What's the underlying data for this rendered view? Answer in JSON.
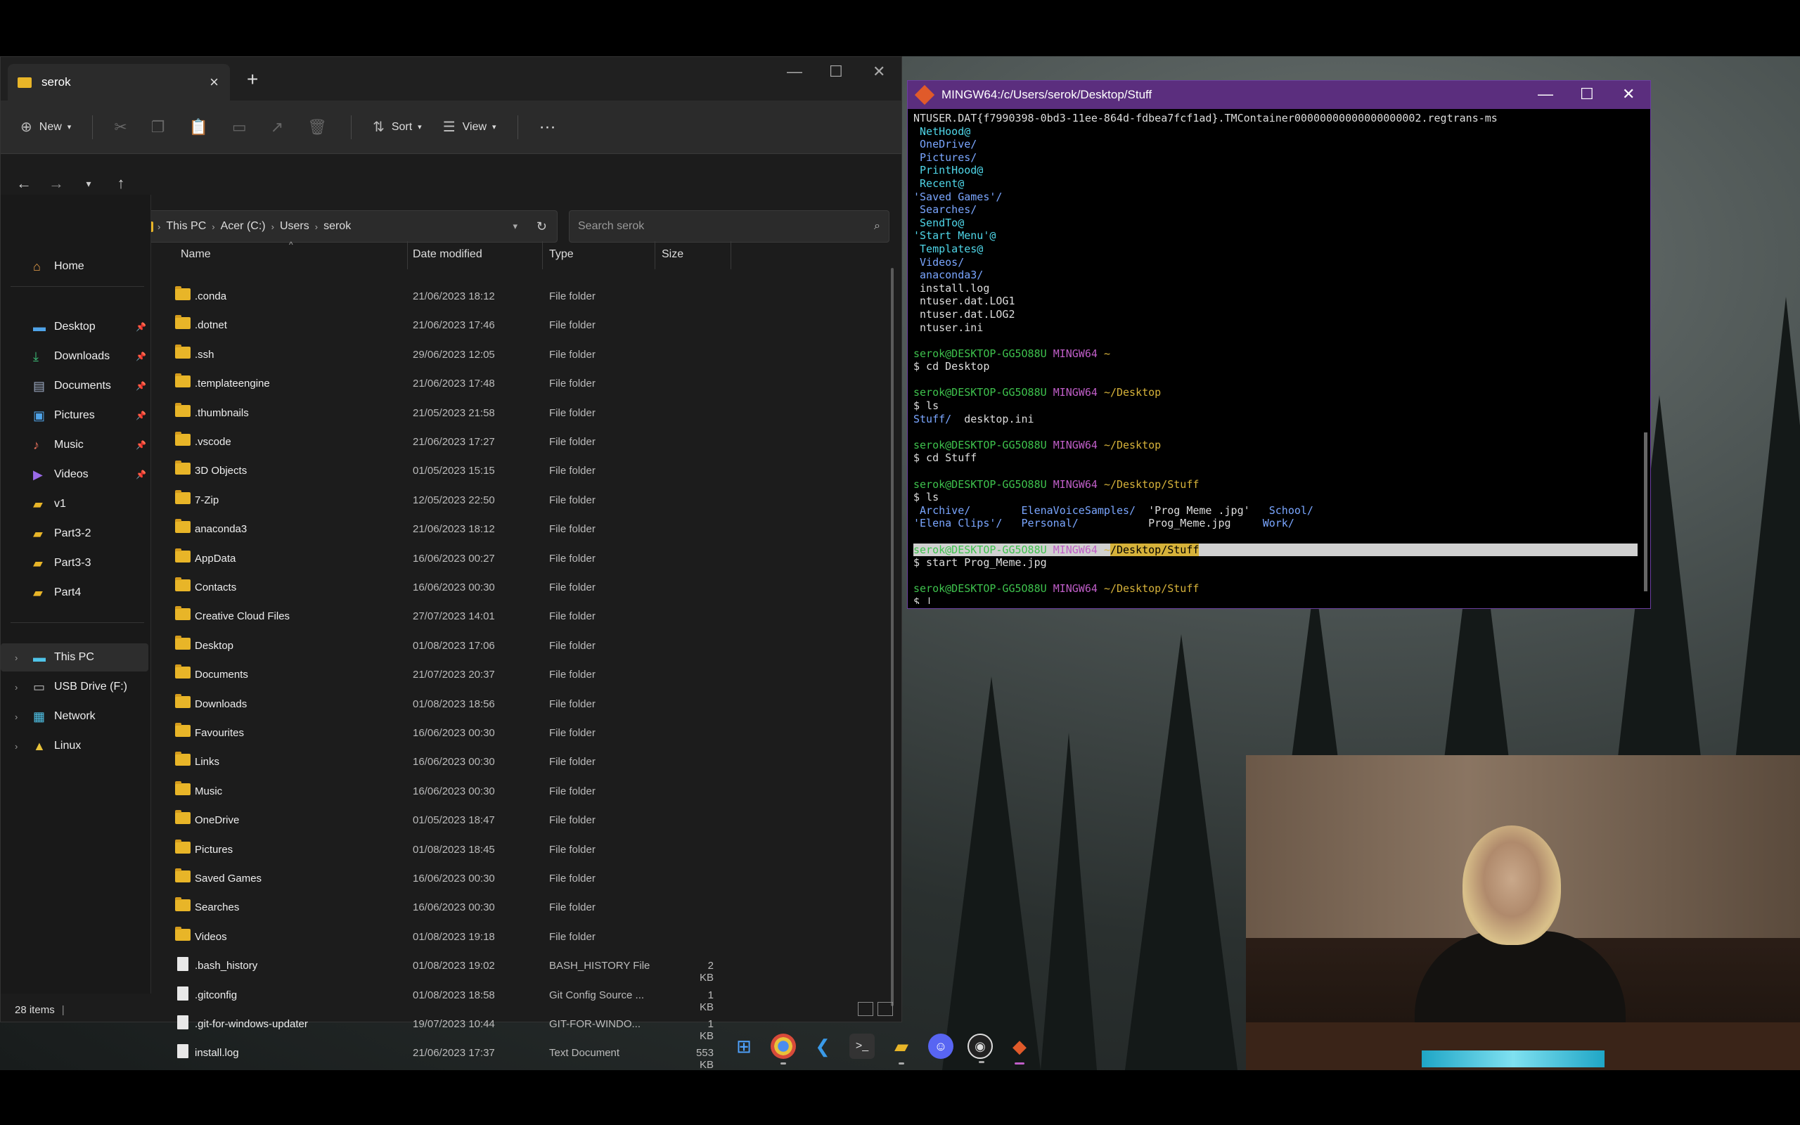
{
  "explorer": {
    "tab_label": "serok",
    "toolbar": {
      "new_label": "New",
      "sort_label": "Sort",
      "view_label": "View"
    },
    "breadcrumb": [
      "This PC",
      "Acer (C:)",
      "Users",
      "serok"
    ],
    "search_placeholder": "Search serok",
    "columns": {
      "name": "Name",
      "date": "Date modified",
      "type": "Type",
      "size": "Size"
    },
    "nav": {
      "home": "Home",
      "quick": [
        {
          "label": "Desktop",
          "icon": "desktop-icon"
        },
        {
          "label": "Downloads",
          "icon": "download-icon"
        },
        {
          "label": "Documents",
          "icon": "documents-icon"
        },
        {
          "label": "Pictures",
          "icon": "pictures-icon"
        },
        {
          "label": "Music",
          "icon": "music-icon"
        },
        {
          "label": "Videos",
          "icon": "videos-icon"
        },
        {
          "label": "v1",
          "icon": "folder-icon"
        },
        {
          "label": "Part3-2",
          "icon": "folder-icon"
        },
        {
          "label": "Part3-3",
          "icon": "folder-icon"
        },
        {
          "label": "Part4",
          "icon": "folder-icon"
        }
      ],
      "this_pc": "This PC",
      "usb": "USB Drive (F:)",
      "network": "Network",
      "linux": "Linux"
    },
    "files": [
      {
        "name": ".conda",
        "date": "21/06/2023 18:12",
        "type": "File folder",
        "size": "",
        "kind": "folder"
      },
      {
        "name": ".dotnet",
        "date": "21/06/2023 17:46",
        "type": "File folder",
        "size": "",
        "kind": "folder"
      },
      {
        "name": ".ssh",
        "date": "29/06/2023 12:05",
        "type": "File folder",
        "size": "",
        "kind": "folder"
      },
      {
        "name": ".templateengine",
        "date": "21/06/2023 17:48",
        "type": "File folder",
        "size": "",
        "kind": "folder"
      },
      {
        "name": ".thumbnails",
        "date": "21/05/2023 21:58",
        "type": "File folder",
        "size": "",
        "kind": "folder"
      },
      {
        "name": ".vscode",
        "date": "21/06/2023 17:27",
        "type": "File folder",
        "size": "",
        "kind": "folder"
      },
      {
        "name": "3D Objects",
        "date": "01/05/2023 15:15",
        "type": "File folder",
        "size": "",
        "kind": "folder"
      },
      {
        "name": "7-Zip",
        "date": "12/05/2023 22:50",
        "type": "File folder",
        "size": "",
        "kind": "folder"
      },
      {
        "name": "anaconda3",
        "date": "21/06/2023 18:12",
        "type": "File folder",
        "size": "",
        "kind": "folder"
      },
      {
        "name": "AppData",
        "date": "16/06/2023 00:27",
        "type": "File folder",
        "size": "",
        "kind": "folder"
      },
      {
        "name": "Contacts",
        "date": "16/06/2023 00:30",
        "type": "File folder",
        "size": "",
        "kind": "folder"
      },
      {
        "name": "Creative Cloud Files",
        "date": "27/07/2023 14:01",
        "type": "File folder",
        "size": "",
        "kind": "folder"
      },
      {
        "name": "Desktop",
        "date": "01/08/2023 17:06",
        "type": "File folder",
        "size": "",
        "kind": "folder"
      },
      {
        "name": "Documents",
        "date": "21/07/2023 20:37",
        "type": "File folder",
        "size": "",
        "kind": "folder"
      },
      {
        "name": "Downloads",
        "date": "01/08/2023 18:56",
        "type": "File folder",
        "size": "",
        "kind": "folder"
      },
      {
        "name": "Favourites",
        "date": "16/06/2023 00:30",
        "type": "File folder",
        "size": "",
        "kind": "folder"
      },
      {
        "name": "Links",
        "date": "16/06/2023 00:30",
        "type": "File folder",
        "size": "",
        "kind": "folder"
      },
      {
        "name": "Music",
        "date": "16/06/2023 00:30",
        "type": "File folder",
        "size": "",
        "kind": "folder"
      },
      {
        "name": "OneDrive",
        "date": "01/05/2023 18:47",
        "type": "File folder",
        "size": "",
        "kind": "folder"
      },
      {
        "name": "Pictures",
        "date": "01/08/2023 18:45",
        "type": "File folder",
        "size": "",
        "kind": "folder"
      },
      {
        "name": "Saved Games",
        "date": "16/06/2023 00:30",
        "type": "File folder",
        "size": "",
        "kind": "folder"
      },
      {
        "name": "Searches",
        "date": "16/06/2023 00:30",
        "type": "File folder",
        "size": "",
        "kind": "folder"
      },
      {
        "name": "Videos",
        "date": "01/08/2023 19:18",
        "type": "File folder",
        "size": "",
        "kind": "folder"
      },
      {
        "name": ".bash_history",
        "date": "01/08/2023 19:02",
        "type": "BASH_HISTORY File",
        "size": "2 KB",
        "kind": "doc"
      },
      {
        "name": ".gitconfig",
        "date": "01/08/2023 18:58",
        "type": "Git Config Source ...",
        "size": "1 KB",
        "kind": "doc"
      },
      {
        "name": ".git-for-windows-updater",
        "date": "19/07/2023 10:44",
        "type": "GIT-FOR-WINDO...",
        "size": "1 KB",
        "kind": "doc"
      },
      {
        "name": "install.log",
        "date": "21/06/2023 17:37",
        "type": "Text Document",
        "size": "553 KB",
        "kind": "doc"
      }
    ],
    "status": "28 items"
  },
  "terminal": {
    "title": "MINGW64:/c/Users/serok/Desktop/Stuff",
    "lines": [
      [
        {
          "t": "NTUSER.DAT{f7990398-0bd3-11ee-864d-fdbea7fcf1ad}.TMContainer00000000000000000002.regtrans-ms",
          "c": ""
        }
      ],
      [
        {
          "t": " NetHood@",
          "c": "c-link"
        }
      ],
      [
        {
          "t": " OneDrive/",
          "c": "c-dir"
        }
      ],
      [
        {
          "t": " Pictures/",
          "c": "c-dir"
        }
      ],
      [
        {
          "t": " PrintHood@",
          "c": "c-link"
        }
      ],
      [
        {
          "t": " Recent@",
          "c": "c-link"
        }
      ],
      [
        {
          "t": "'Saved Games'/",
          "c": "c-dir"
        }
      ],
      [
        {
          "t": " Searches/",
          "c": "c-dir"
        }
      ],
      [
        {
          "t": " SendTo@",
          "c": "c-link"
        }
      ],
      [
        {
          "t": "'Start Menu'@",
          "c": "c-link"
        }
      ],
      [
        {
          "t": " Templates@",
          "c": "c-link"
        }
      ],
      [
        {
          "t": " Videos/",
          "c": "c-dir"
        }
      ],
      [
        {
          "t": " anaconda3/",
          "c": "c-dir"
        }
      ],
      [
        {
          "t": " install.log",
          "c": ""
        }
      ],
      [
        {
          "t": " ntuser.dat.LOG1",
          "c": ""
        }
      ],
      [
        {
          "t": " ntuser.dat.LOG2",
          "c": ""
        }
      ],
      [
        {
          "t": " ntuser.ini",
          "c": ""
        }
      ],
      [
        {
          "t": "",
          "c": ""
        }
      ],
      [
        {
          "t": "serok@DESKTOP-GG5O88U ",
          "c": "c-user"
        },
        {
          "t": "MINGW64 ",
          "c": "c-host"
        },
        {
          "t": "~",
          "c": "c-path"
        }
      ],
      [
        {
          "t": "$ cd Desktop",
          "c": ""
        }
      ],
      [
        {
          "t": "",
          "c": ""
        }
      ],
      [
        {
          "t": "serok@DESKTOP-GG5O88U ",
          "c": "c-user"
        },
        {
          "t": "MINGW64 ",
          "c": "c-host"
        },
        {
          "t": "~/Desktop",
          "c": "c-path"
        }
      ],
      [
        {
          "t": "$ ls",
          "c": ""
        }
      ],
      [
        {
          "t": "Stuff/",
          "c": "c-dir"
        },
        {
          "t": "  desktop.ini",
          "c": ""
        }
      ],
      [
        {
          "t": "",
          "c": ""
        }
      ],
      [
        {
          "t": "serok@DESKTOP-GG5O88U ",
          "c": "c-user"
        },
        {
          "t": "MINGW64 ",
          "c": "c-host"
        },
        {
          "t": "~/Desktop",
          "c": "c-path"
        }
      ],
      [
        {
          "t": "$ cd Stuff",
          "c": ""
        }
      ],
      [
        {
          "t": "",
          "c": ""
        }
      ],
      [
        {
          "t": "serok@DESKTOP-GG5O88U ",
          "c": "c-user"
        },
        {
          "t": "MINGW64 ",
          "c": "c-host"
        },
        {
          "t": "~/Desktop/Stuff",
          "c": "c-path"
        }
      ],
      [
        {
          "t": "$ ls",
          "c": ""
        }
      ],
      [
        {
          "t": " Archive/",
          "c": "c-dir"
        },
        {
          "t": "        ",
          "c": ""
        },
        {
          "t": "ElenaVoiceSamples/",
          "c": "c-dir"
        },
        {
          "t": "  'Prog Meme .jpg'   ",
          "c": ""
        },
        {
          "t": "School/",
          "c": "c-dir"
        }
      ],
      [
        {
          "t": "'Elena Clips'/",
          "c": "c-dir"
        },
        {
          "t": "   ",
          "c": ""
        },
        {
          "t": "Personal/",
          "c": "c-dir"
        },
        {
          "t": "           Prog_Meme.jpg     ",
          "c": ""
        },
        {
          "t": "Work/",
          "c": "c-dir"
        }
      ],
      [
        {
          "t": "",
          "c": ""
        }
      ],
      [
        {
          "t": "serok@DESKTOP-GG5O88U ",
          "c": "c-user"
        },
        {
          "t": "MINGW64 ",
          "c": "c-host"
        },
        {
          "t": "~",
          "c": "c-path"
        },
        {
          "t": "/Desktop/Stuff",
          "c": "c-hl"
        }
      ],
      [
        {
          "t": "$ start Prog_Meme.jpg",
          "c": ""
        }
      ],
      [
        {
          "t": "",
          "c": ""
        }
      ],
      [
        {
          "t": "serok@DESKTOP-GG5O88U ",
          "c": "c-user"
        },
        {
          "t": "MINGW64 ",
          "c": "c-host"
        },
        {
          "t": "~/Desktop/Stuff",
          "c": "c-path"
        }
      ],
      [
        {
          "t": "$ |",
          "c": ""
        }
      ]
    ]
  },
  "taskbar": [
    "start-icon",
    "chrome-icon",
    "vscode-icon",
    "terminal-icon",
    "file-explorer-icon",
    "discord-icon",
    "obs-icon",
    "git-bash-icon"
  ],
  "colors": {
    "folder": "#e8b528",
    "terminal_title": "#5b2e7e",
    "prompt_user": "#3ec24d",
    "prompt_host": "#c05ec8",
    "prompt_path": "#d6b23a"
  }
}
